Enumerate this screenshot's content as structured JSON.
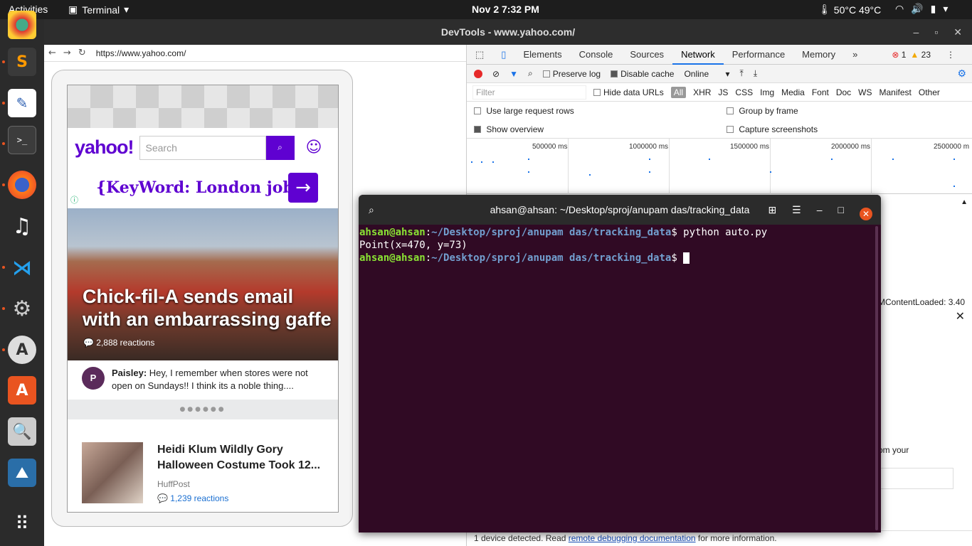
{
  "topbar": {
    "activities": "Activities",
    "app": "Terminal",
    "clock": "Nov 2  7:32 PM",
    "temp": "50°C 49°C"
  },
  "window": {
    "title": "DevTools - www.yahoo.com/"
  },
  "browser": {
    "url": "https://www.yahoo.com/"
  },
  "yahoo": {
    "logo": "yahoo!",
    "search_placeholder": "Search",
    "ad_text": "{KeyWord: London jobs}",
    "hero_title": "Chick-fil-A sends email with an embarrassing gaffe",
    "hero_reactions": "2,888 reactions",
    "comment_author": "Paisley:",
    "comment_text": " Hey, I remember when stores were not open on Sundays!! I think its a noble thing....",
    "story_title": "Heidi Klum Wildly Gory Halloween Costume Took 12...",
    "story_source": "HuffPost",
    "story_reactions": "1,239 reactions"
  },
  "devtools": {
    "tabs": [
      "Elements",
      "Console",
      "Sources",
      "Network",
      "Performance",
      "Memory"
    ],
    "errors": "1",
    "warnings": "23",
    "preserve_log": "Preserve log",
    "disable_cache": "Disable cache",
    "throttle": "Online",
    "filter_placeholder": "Filter",
    "hide_data_urls": "Hide data URLs",
    "types": [
      "All",
      "XHR",
      "JS",
      "CSS",
      "Img",
      "Media",
      "Font",
      "Doc",
      "WS",
      "Manifest",
      "Other"
    ],
    "use_large_rows": "Use large request rows",
    "group_by_frame": "Group by frame",
    "show_overview": "Show overview",
    "capture_screenshots": "Capture screenshots",
    "ticks": [
      "500000 ms",
      "1000000 ms",
      "1500000 ms",
      "2000000 ms",
      "2500000 m"
    ],
    "dom_loaded": "MContentLoaded: 3.40",
    "side_text": "om your",
    "status_prefix": "1 device detected. Read ",
    "status_link": "remote debugging documentation",
    "status_suffix": " for more information."
  },
  "terminal": {
    "title": "ahsan@ahsan: ~/Desktop/sproj/anupam das/tracking_data",
    "user": "ahsan@ahsan",
    "path": "~/Desktop/sproj/anupam das/tracking_data",
    "command": " python auto.py",
    "output": "Point(x=470, y=73)"
  }
}
